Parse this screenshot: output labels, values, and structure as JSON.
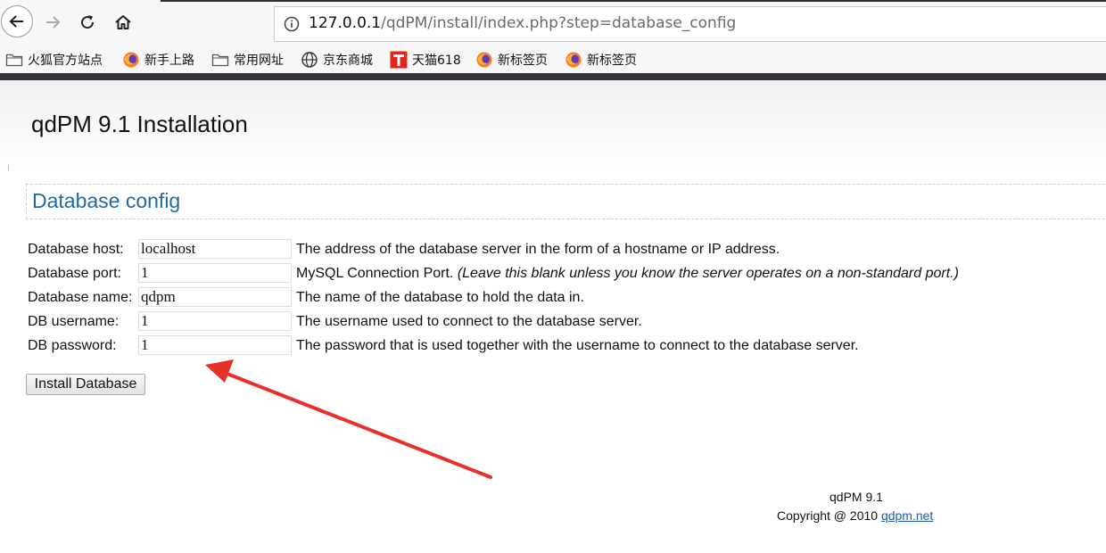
{
  "browser": {
    "url_host": "127.0.0.1",
    "url_path": "/qdPM/install/index.php?step=database_config",
    "bookmarks": [
      {
        "label": "火狐官方站点",
        "icon": "folder-icon"
      },
      {
        "label": "新手上路",
        "icon": "firefox-icon"
      },
      {
        "label": "常用网址",
        "icon": "folder-icon"
      },
      {
        "label": "京东商城",
        "icon": "globe-icon"
      },
      {
        "label": "天猫618",
        "icon": "tmall-icon"
      },
      {
        "label": "新标签页",
        "icon": "firefox-icon"
      },
      {
        "label": "新标签页",
        "icon": "firefox-icon"
      }
    ]
  },
  "page": {
    "title": "qdPM 9.1 Installation",
    "section_title": "Database config"
  },
  "form": {
    "host": {
      "label": "Database host:",
      "value": "localhost",
      "desc": "The address of the database server in the form of a hostname or IP address."
    },
    "port": {
      "label": "Database port:",
      "value": "1",
      "desc": "MySQL Connection Port.",
      "desc_note": "(Leave this blank unless you know the server operates on a non-standard port.)"
    },
    "name": {
      "label": "Database name:",
      "value": "qdpm",
      "desc": "The name of the database to hold the data in."
    },
    "username": {
      "label": "DB username:",
      "value": "1",
      "desc": "The username used to connect to the database server."
    },
    "password": {
      "label": "DB password:",
      "value": "1",
      "desc": "The password that is used together with the username to connect to the database server."
    },
    "submit_label": "Install Database"
  },
  "footer": {
    "version": "qdPM 9.1",
    "copyright": "Copyright @ 2010",
    "link": "qdpm.net"
  },
  "colors": {
    "section_title": "#1f6aa0",
    "annotation_arrow": "#e8302a",
    "link": "#1a5ea8"
  }
}
